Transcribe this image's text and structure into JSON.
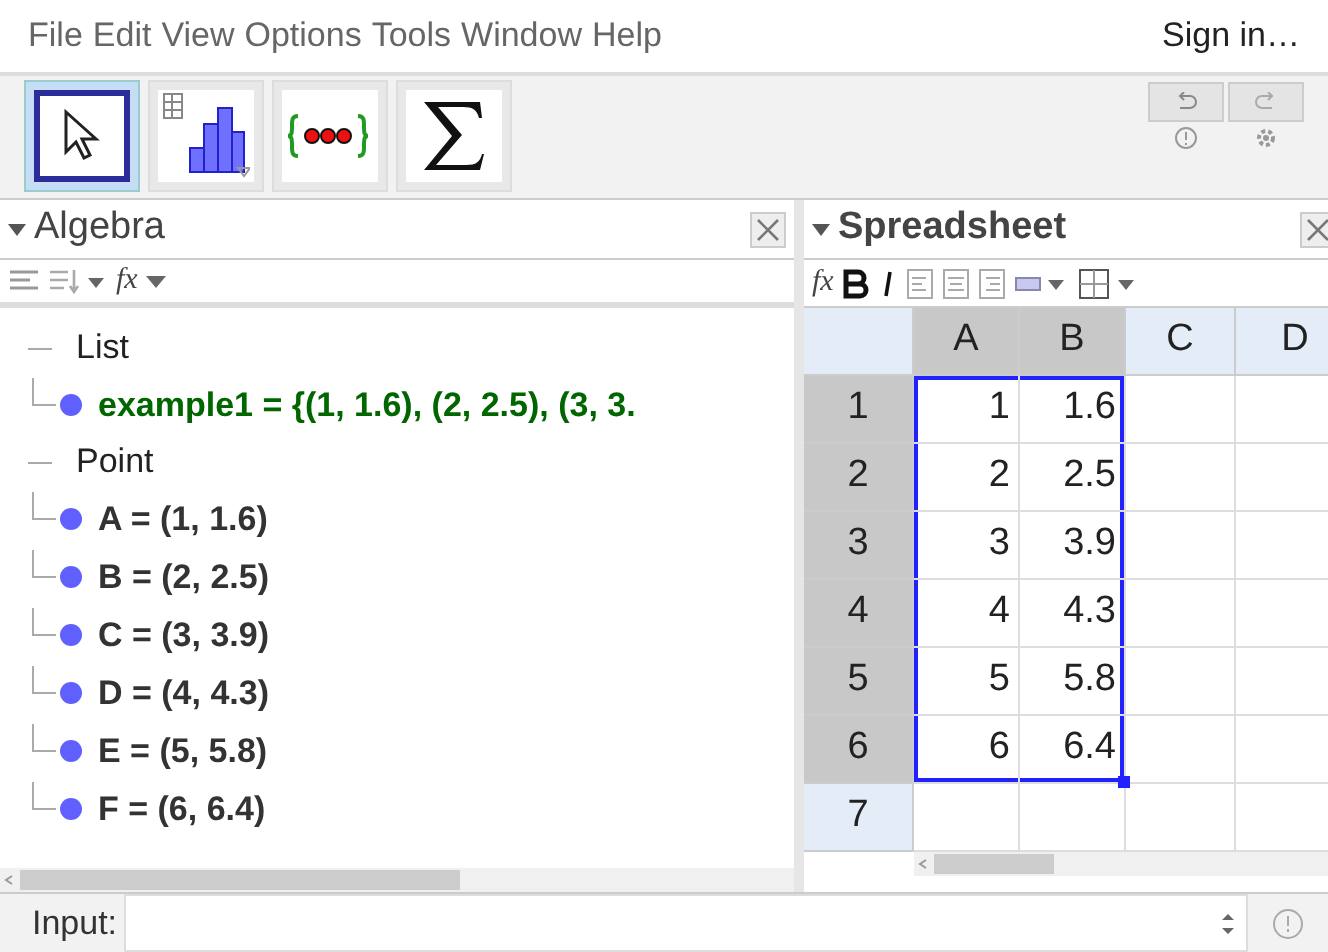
{
  "menu": [
    "File",
    "Edit",
    "View",
    "Options",
    "Tools",
    "Window",
    "Help"
  ],
  "sign_in": "Sign in…",
  "tools": [
    {
      "kind": "move",
      "selected": true
    },
    {
      "kind": "chart",
      "selected": false
    },
    {
      "kind": "list",
      "selected": false
    },
    {
      "kind": "sum",
      "selected": false
    }
  ],
  "algebra": {
    "title": "Algebra",
    "function_button": "fx",
    "groups": [
      {
        "label": "List",
        "expanded": true,
        "children": [
          {
            "text": "example1 = {(1, 1.6), (2, 2.5), (3, 3.",
            "color": "#006600"
          }
        ]
      },
      {
        "label": "Point",
        "expanded": true,
        "children": [
          {
            "text": "A = (1, 1.6)",
            "color": "#333333"
          },
          {
            "text": "B = (2, 2.5)",
            "color": "#333333"
          },
          {
            "text": "C = (3, 3.9)",
            "color": "#333333"
          },
          {
            "text": "D = (4, 4.3)",
            "color": "#333333"
          },
          {
            "text": "E = (5, 5.8)",
            "color": "#333333"
          },
          {
            "text": "F = (6, 6.4)",
            "color": "#333333"
          }
        ]
      }
    ]
  },
  "spreadsheet": {
    "title": "Spreadsheet",
    "function_button": "fx",
    "columns": [
      {
        "label": "A",
        "selected": true
      },
      {
        "label": "B",
        "selected": true
      },
      {
        "label": "C",
        "selected": false
      },
      {
        "label": "D",
        "selected": false
      }
    ],
    "rows": [
      {
        "label": "1",
        "selected": true,
        "cells": [
          "1",
          "1.6"
        ]
      },
      {
        "label": "2",
        "selected": true,
        "cells": [
          "2",
          "2.5"
        ]
      },
      {
        "label": "3",
        "selected": true,
        "cells": [
          "3",
          "3.9"
        ]
      },
      {
        "label": "4",
        "selected": true,
        "cells": [
          "4",
          "4.3"
        ]
      },
      {
        "label": "5",
        "selected": true,
        "cells": [
          "5",
          "5.8"
        ]
      },
      {
        "label": "6",
        "selected": true,
        "cells": [
          "6",
          "6.4"
        ]
      },
      {
        "label": "7",
        "selected": false
      }
    ]
  },
  "input": {
    "label": "Input:"
  }
}
